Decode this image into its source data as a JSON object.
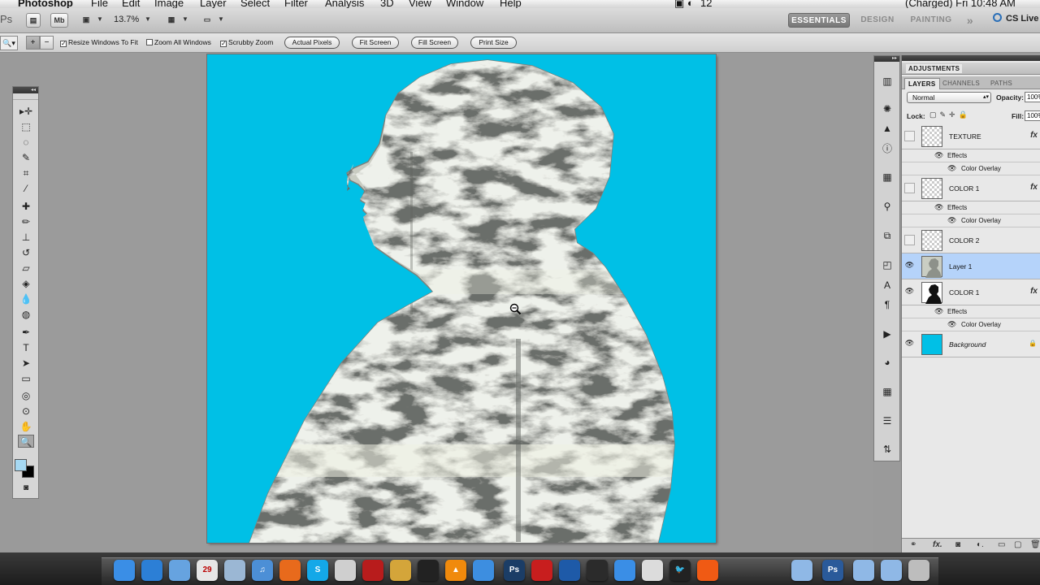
{
  "menubar": {
    "app": "Photoshop",
    "items": [
      "File",
      "Edit",
      "Image",
      "Layer",
      "Select",
      "Filter",
      "Analysis",
      "3D",
      "View",
      "Window",
      "Help"
    ],
    "status_right": "(Charged)  Fri 10:48 AM",
    "wifi_count": "12"
  },
  "appbar": {
    "ps_label": "Ps",
    "mb_label": "Mb",
    "zoom": "13.7%",
    "workspaces": [
      "ESSENTIALS",
      "DESIGN",
      "PAINTING"
    ],
    "more": "»",
    "cslive": "CS Live"
  },
  "options": {
    "checks": [
      {
        "label": "Resize Windows To Fit",
        "checked": true
      },
      {
        "label": "Zoom All Windows",
        "checked": false
      },
      {
        "label": "Scrubby Zoom",
        "checked": true
      }
    ],
    "buttons": [
      "Actual Pixels",
      "Fit Screen",
      "Fill Screen",
      "Print Size"
    ]
  },
  "tools": {
    "items": [
      {
        "name": "move-tool-icon",
        "glyph": "▸✛"
      },
      {
        "name": "marquee-tool-icon",
        "glyph": "⬚"
      },
      {
        "name": "lasso-tool-icon",
        "glyph": "◌"
      },
      {
        "name": "quick-select-tool-icon",
        "glyph": "✎"
      },
      {
        "name": "crop-tool-icon",
        "glyph": "⌗"
      },
      {
        "name": "eyedropper-tool-icon",
        "glyph": "⁄"
      },
      {
        "name": "healing-brush-tool-icon",
        "glyph": "✚"
      },
      {
        "name": "brush-tool-icon",
        "glyph": "✏"
      },
      {
        "name": "clone-stamp-tool-icon",
        "glyph": "⊥"
      },
      {
        "name": "history-brush-tool-icon",
        "glyph": "↺"
      },
      {
        "name": "eraser-tool-icon",
        "glyph": "▱"
      },
      {
        "name": "paint-bucket-tool-icon",
        "glyph": "◈"
      },
      {
        "name": "blur-tool-icon",
        "glyph": "💧"
      },
      {
        "name": "dodge-tool-icon",
        "glyph": "◍"
      },
      {
        "name": "pen-tool-icon",
        "glyph": "✒"
      },
      {
        "name": "type-tool-icon",
        "glyph": "T"
      },
      {
        "name": "path-select-tool-icon",
        "glyph": "➤"
      },
      {
        "name": "shape-tool-icon",
        "glyph": "▭"
      },
      {
        "name": "3d-rotate-tool-icon",
        "glyph": "◎"
      },
      {
        "name": "3d-orbit-tool-icon",
        "glyph": "⊙"
      },
      {
        "name": "hand-tool-icon",
        "glyph": "✋"
      },
      {
        "name": "zoom-tool-icon",
        "glyph": "🔍"
      }
    ],
    "foreground_color": "#a6d8f2",
    "background_color": "#000000"
  },
  "document": {
    "background_color": "#00c0e6"
  },
  "panel": {
    "adjustments_tab": "ADJUSTMENTS",
    "tabs": [
      "LAYERS",
      "CHANNELS",
      "PATHS"
    ],
    "blend_mode": "Normal",
    "opacity_label": "Opacity:",
    "opacity_value": "100%",
    "lock_label": "Lock:",
    "fill_label": "Fill:",
    "fill_value": "100%",
    "effects_label": "Effects",
    "color_overlay_label": "Color Overlay",
    "layers": [
      {
        "name": "TEXTURE",
        "visible": false,
        "fx": true,
        "thumb": "checker",
        "effects": [
          "Color Overlay"
        ]
      },
      {
        "name": "COLOR  1",
        "visible": false,
        "fx": true,
        "thumb": "checker",
        "effects": [
          "Color Overlay"
        ]
      },
      {
        "name": "COLOR 2",
        "visible": false,
        "fx": false,
        "thumb": "checker",
        "effects": []
      },
      {
        "name": "Layer 1",
        "visible": true,
        "fx": false,
        "thumb": "photo",
        "selected": true,
        "effects": []
      },
      {
        "name": "COLOR 1",
        "visible": true,
        "fx": true,
        "thumb": "silhouette",
        "effects": [
          "Color Overlay"
        ]
      },
      {
        "name": "Background",
        "visible": true,
        "fx": false,
        "thumb": "blue",
        "locked": true,
        "italic": true,
        "effects": []
      }
    ]
  },
  "colors": {
    "selected_layer": "#b5d3fa",
    "canvas_blue": "#00c0e6",
    "texture_light": "#dfe3d4",
    "texture_dark": "#6b6e6a"
  }
}
